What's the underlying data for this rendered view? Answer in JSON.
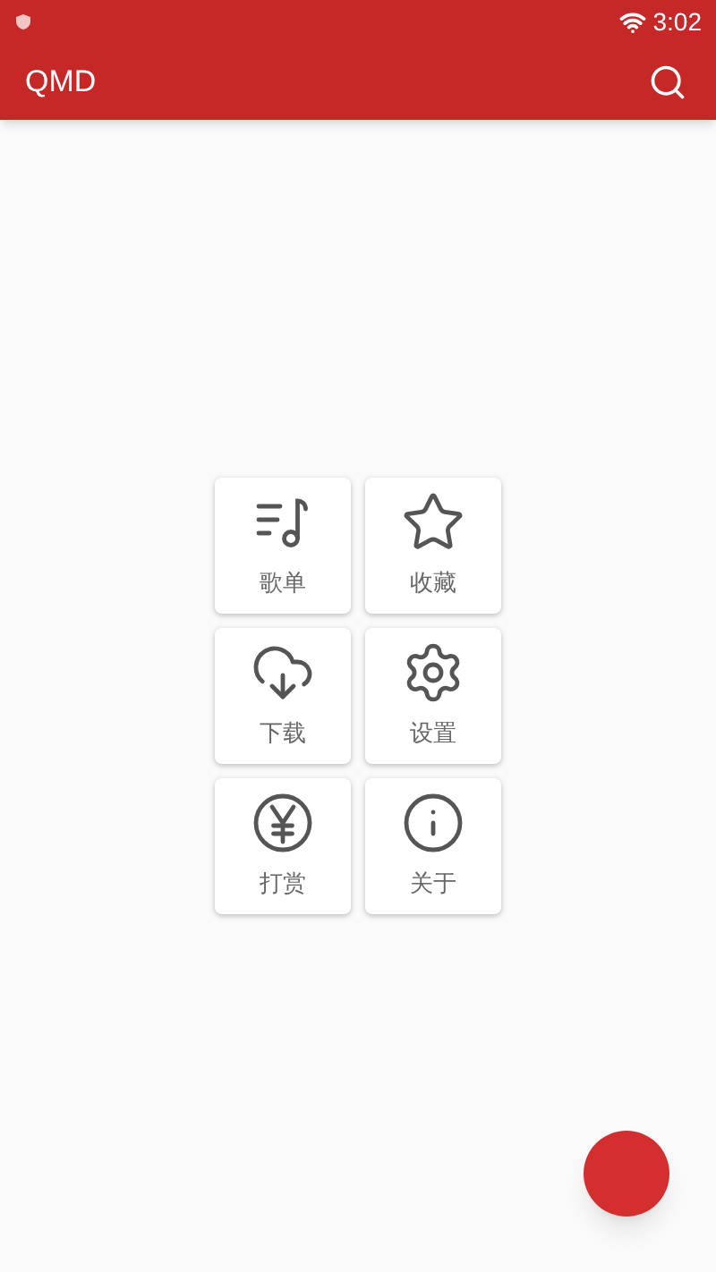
{
  "status_bar": {
    "time": "3:02"
  },
  "app_bar": {
    "title": "QMD"
  },
  "menu": [
    {
      "kind": "playlist",
      "label": "歌单"
    },
    {
      "kind": "star",
      "label": "收藏"
    },
    {
      "kind": "download",
      "label": "下载"
    },
    {
      "kind": "settings",
      "label": "设置"
    },
    {
      "kind": "reward",
      "label": "打赏"
    },
    {
      "kind": "about",
      "label": "关于"
    }
  ]
}
